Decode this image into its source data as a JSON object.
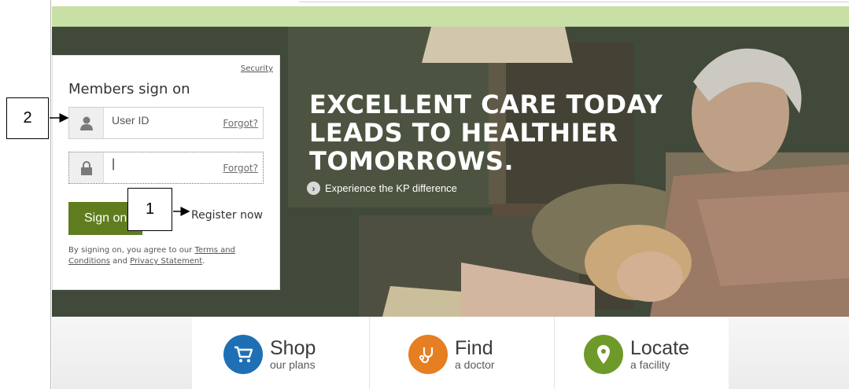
{
  "hero": {
    "headline": [
      "EXCELLENT CARE TODAY",
      "LEADS TO HEALTHIER",
      "TOMORROWS."
    ],
    "cta_label": "Experience the KP difference"
  },
  "signon": {
    "security_label": "Security",
    "title": "Members sign on",
    "userid_placeholder": "User ID",
    "userid_forgot": "Forgot?",
    "password_value": "|",
    "password_forgot": "Forgot?",
    "signon_button": "Sign on",
    "register_link": "Register now",
    "terms_prefix": "By signing on, you agree to our",
    "terms_link": "Terms and Conditions",
    "terms_and": "and",
    "privacy_link": "Privacy Statement",
    "terms_suffix": "."
  },
  "callouts": {
    "one": "1",
    "two": "2"
  },
  "actions": [
    {
      "title": "Shop",
      "subtitle": "our plans",
      "icon": "cart-icon",
      "color": "#1f6fb5"
    },
    {
      "title": "Find",
      "subtitle": "a doctor",
      "icon": "stethoscope-icon",
      "color": "#e67e22"
    },
    {
      "title": "Locate",
      "subtitle": "a facility",
      "icon": "map-pin-icon",
      "color": "#6e9a2a"
    }
  ],
  "colors": {
    "brand_green": "#5f7d1f",
    "top_strip": "#c8dfa5"
  }
}
